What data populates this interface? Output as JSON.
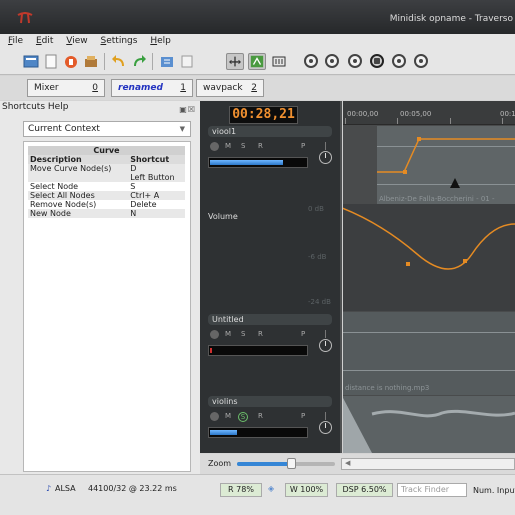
{
  "window": {
    "title": "Minidisk opname - Traverso"
  },
  "menu": [
    "File",
    "Edit",
    "View",
    "Settings",
    "Help"
  ],
  "toolbar": {
    "icons": [
      "new-project-icon",
      "open-project-icon",
      "record-settings-icon",
      "export-icon",
      "undo-icon",
      "redo-icon",
      "import-audio-icon",
      "restore-icon",
      "snap-icon",
      "follow-playhead-icon",
      "crop-icon",
      "to-start-icon",
      "rewind-icon",
      "stop-icon",
      "play-icon",
      "forward-icon",
      "to-end-icon"
    ]
  },
  "tabs": [
    {
      "label": "Mixer",
      "number": "0"
    },
    {
      "label": "renamed",
      "number": "1"
    },
    {
      "label": "wavpack",
      "number": "2"
    }
  ],
  "shortcuts_panel": {
    "title": "Shortcuts Help",
    "context": "Current Context",
    "caption": "Curve",
    "col_description": "Description",
    "col_shortcut": "Shortcut",
    "rows": [
      {
        "description": "Move Curve Node(s)",
        "shortcut": "D\nLeft Button"
      },
      {
        "description": "Select Node",
        "shortcut": "S"
      },
      {
        "description": "Select All Nodes",
        "shortcut": "Ctrl+ A"
      },
      {
        "description": "Remove Node(s)",
        "shortcut": "Delete"
      },
      {
        "description": "New Node",
        "shortcut": "N"
      }
    ]
  },
  "transport": {
    "timecode": "00:28,21"
  },
  "ruler": {
    "ticks": [
      "00:00,00",
      "00:05,00",
      "00:1"
    ]
  },
  "tracks": [
    {
      "name": "viool1",
      "buttons": [
        "M",
        "S",
        "R",
        "P"
      ],
      "level": 0.75,
      "solo": false
    },
    {
      "name": "Untitled",
      "buttons": [
        "M",
        "S",
        "R",
        "P"
      ],
      "level": 0.02,
      "solo": false
    },
    {
      "name": "violins",
      "buttons": [
        "M",
        "S",
        "R",
        "P"
      ],
      "level": 0.28,
      "solo": true
    }
  ],
  "curve_view": {
    "label": "Volume",
    "db_labels": [
      "0 dB",
      "-6 dB",
      "-24 dB"
    ]
  },
  "clips": [
    {
      "name": "Albeniz-De Falla-Boccherini - 01 -"
    },
    {
      "name": "distance is nothing.mp3"
    }
  ],
  "zoom": {
    "label": "Zoom",
    "value": 0.55
  },
  "status": {
    "audio_driver": "ALSA",
    "audio_info": "44100/32 @ 23.22 ms",
    "read": "R 78%",
    "write": "W 100%",
    "dsp": "DSP 6.50%",
    "track_finder_placeholder": "Track Finder",
    "num_input": "Num. Input"
  },
  "colors": {
    "accent_orange": "#f09030",
    "meter_blue": "#3586d6",
    "tab_current": "#2333c0",
    "title_bar": "#2f3133"
  }
}
